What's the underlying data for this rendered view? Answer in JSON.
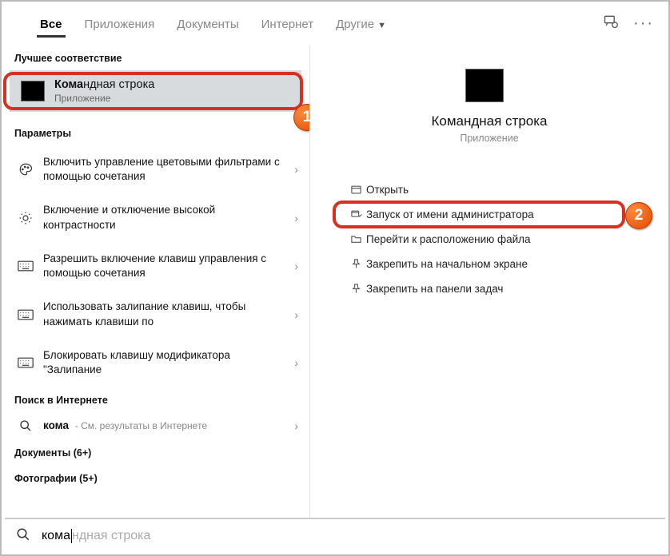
{
  "tabs": {
    "all": "Все",
    "apps": "Приложения",
    "docs": "Документы",
    "internet": "Интернет",
    "more": "Другие"
  },
  "left": {
    "bestMatchLabel": "Лучшее соответствие",
    "best": {
      "strong": "Кома",
      "rest": "ндная строка",
      "sub": "Приложение"
    },
    "settingsLabel": "Параметры",
    "settings": [
      "Включить управление цветовыми фильтрами с помощью сочетания",
      "Включение и отключение высокой контрастности",
      "Разрешить включение клавиш управления с помощью сочетания",
      "Использовать залипание клавиш, чтобы нажимать клавиши по",
      "Блокировать клавишу модификатора \"Залипание"
    ],
    "webLabel": "Поиск в Интернете",
    "web": {
      "query": "кома",
      "hint": "- См. результаты в Интернете"
    },
    "docsGroup": "Документы (6+)",
    "photosGroup": "Фотографии (5+)"
  },
  "right": {
    "title": "Командная строка",
    "sub": "Приложение",
    "actions": {
      "open": "Открыть",
      "runAdmin": "Запуск от имени администратора",
      "location": "Перейти к расположению файла",
      "pinStart": "Закрепить на начальном экране",
      "pinTaskbar": "Закрепить на панели задач"
    }
  },
  "search": {
    "typed": "кома",
    "completion": "ндная строка"
  },
  "badges": {
    "one": "1",
    "two": "2"
  }
}
